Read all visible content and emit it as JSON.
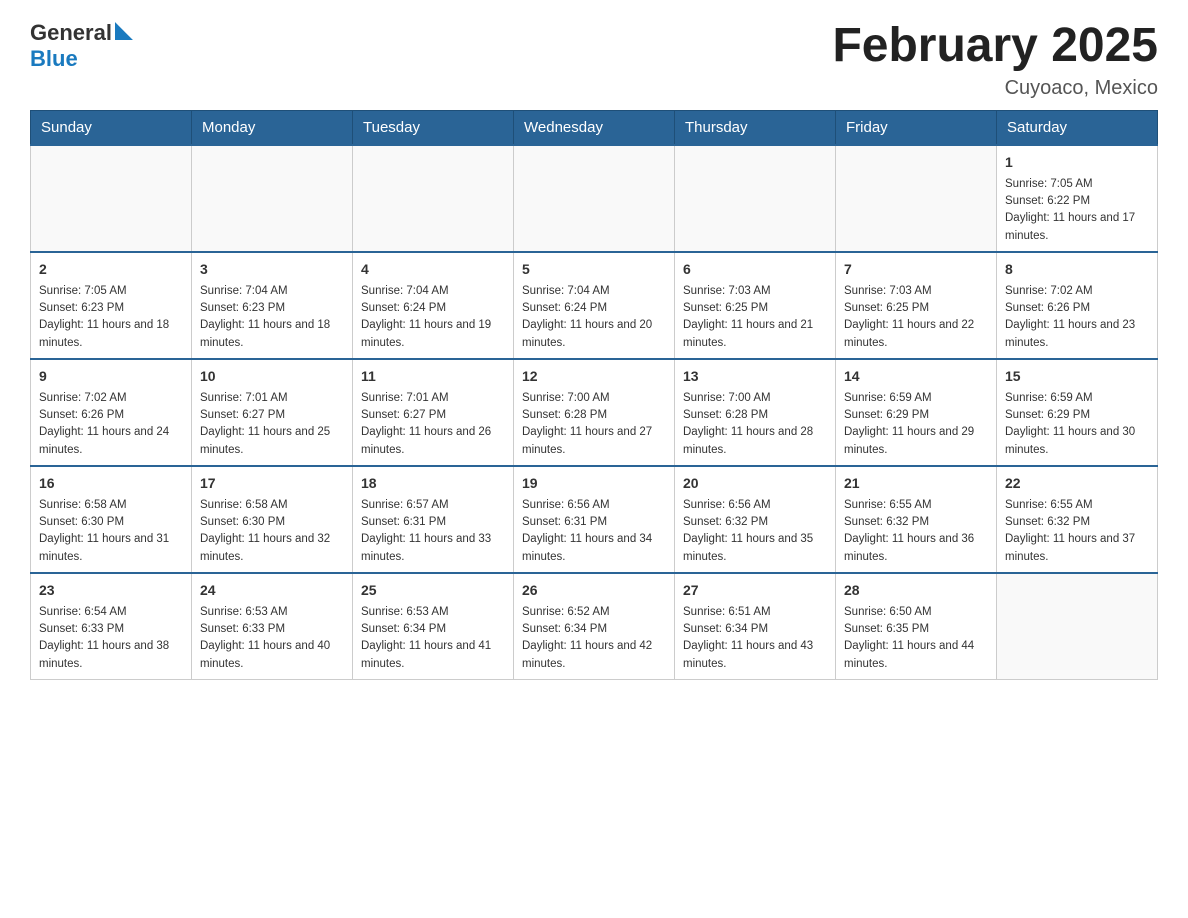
{
  "header": {
    "logo_general": "General",
    "logo_blue": "Blue",
    "title": "February 2025",
    "subtitle": "Cuyoaco, Mexico"
  },
  "weekdays": [
    "Sunday",
    "Monday",
    "Tuesday",
    "Wednesday",
    "Thursday",
    "Friday",
    "Saturday"
  ],
  "weeks": [
    [
      {
        "day": "",
        "sunrise": "",
        "sunset": "",
        "daylight": ""
      },
      {
        "day": "",
        "sunrise": "",
        "sunset": "",
        "daylight": ""
      },
      {
        "day": "",
        "sunrise": "",
        "sunset": "",
        "daylight": ""
      },
      {
        "day": "",
        "sunrise": "",
        "sunset": "",
        "daylight": ""
      },
      {
        "day": "",
        "sunrise": "",
        "sunset": "",
        "daylight": ""
      },
      {
        "day": "",
        "sunrise": "",
        "sunset": "",
        "daylight": ""
      },
      {
        "day": "1",
        "sunrise": "Sunrise: 7:05 AM",
        "sunset": "Sunset: 6:22 PM",
        "daylight": "Daylight: 11 hours and 17 minutes."
      }
    ],
    [
      {
        "day": "2",
        "sunrise": "Sunrise: 7:05 AM",
        "sunset": "Sunset: 6:23 PM",
        "daylight": "Daylight: 11 hours and 18 minutes."
      },
      {
        "day": "3",
        "sunrise": "Sunrise: 7:04 AM",
        "sunset": "Sunset: 6:23 PM",
        "daylight": "Daylight: 11 hours and 18 minutes."
      },
      {
        "day": "4",
        "sunrise": "Sunrise: 7:04 AM",
        "sunset": "Sunset: 6:24 PM",
        "daylight": "Daylight: 11 hours and 19 minutes."
      },
      {
        "day": "5",
        "sunrise": "Sunrise: 7:04 AM",
        "sunset": "Sunset: 6:24 PM",
        "daylight": "Daylight: 11 hours and 20 minutes."
      },
      {
        "day": "6",
        "sunrise": "Sunrise: 7:03 AM",
        "sunset": "Sunset: 6:25 PM",
        "daylight": "Daylight: 11 hours and 21 minutes."
      },
      {
        "day": "7",
        "sunrise": "Sunrise: 7:03 AM",
        "sunset": "Sunset: 6:25 PM",
        "daylight": "Daylight: 11 hours and 22 minutes."
      },
      {
        "day": "8",
        "sunrise": "Sunrise: 7:02 AM",
        "sunset": "Sunset: 6:26 PM",
        "daylight": "Daylight: 11 hours and 23 minutes."
      }
    ],
    [
      {
        "day": "9",
        "sunrise": "Sunrise: 7:02 AM",
        "sunset": "Sunset: 6:26 PM",
        "daylight": "Daylight: 11 hours and 24 minutes."
      },
      {
        "day": "10",
        "sunrise": "Sunrise: 7:01 AM",
        "sunset": "Sunset: 6:27 PM",
        "daylight": "Daylight: 11 hours and 25 minutes."
      },
      {
        "day": "11",
        "sunrise": "Sunrise: 7:01 AM",
        "sunset": "Sunset: 6:27 PM",
        "daylight": "Daylight: 11 hours and 26 minutes."
      },
      {
        "day": "12",
        "sunrise": "Sunrise: 7:00 AM",
        "sunset": "Sunset: 6:28 PM",
        "daylight": "Daylight: 11 hours and 27 minutes."
      },
      {
        "day": "13",
        "sunrise": "Sunrise: 7:00 AM",
        "sunset": "Sunset: 6:28 PM",
        "daylight": "Daylight: 11 hours and 28 minutes."
      },
      {
        "day": "14",
        "sunrise": "Sunrise: 6:59 AM",
        "sunset": "Sunset: 6:29 PM",
        "daylight": "Daylight: 11 hours and 29 minutes."
      },
      {
        "day": "15",
        "sunrise": "Sunrise: 6:59 AM",
        "sunset": "Sunset: 6:29 PM",
        "daylight": "Daylight: 11 hours and 30 minutes."
      }
    ],
    [
      {
        "day": "16",
        "sunrise": "Sunrise: 6:58 AM",
        "sunset": "Sunset: 6:30 PM",
        "daylight": "Daylight: 11 hours and 31 minutes."
      },
      {
        "day": "17",
        "sunrise": "Sunrise: 6:58 AM",
        "sunset": "Sunset: 6:30 PM",
        "daylight": "Daylight: 11 hours and 32 minutes."
      },
      {
        "day": "18",
        "sunrise": "Sunrise: 6:57 AM",
        "sunset": "Sunset: 6:31 PM",
        "daylight": "Daylight: 11 hours and 33 minutes."
      },
      {
        "day": "19",
        "sunrise": "Sunrise: 6:56 AM",
        "sunset": "Sunset: 6:31 PM",
        "daylight": "Daylight: 11 hours and 34 minutes."
      },
      {
        "day": "20",
        "sunrise": "Sunrise: 6:56 AM",
        "sunset": "Sunset: 6:32 PM",
        "daylight": "Daylight: 11 hours and 35 minutes."
      },
      {
        "day": "21",
        "sunrise": "Sunrise: 6:55 AM",
        "sunset": "Sunset: 6:32 PM",
        "daylight": "Daylight: 11 hours and 36 minutes."
      },
      {
        "day": "22",
        "sunrise": "Sunrise: 6:55 AM",
        "sunset": "Sunset: 6:32 PM",
        "daylight": "Daylight: 11 hours and 37 minutes."
      }
    ],
    [
      {
        "day": "23",
        "sunrise": "Sunrise: 6:54 AM",
        "sunset": "Sunset: 6:33 PM",
        "daylight": "Daylight: 11 hours and 38 minutes."
      },
      {
        "day": "24",
        "sunrise": "Sunrise: 6:53 AM",
        "sunset": "Sunset: 6:33 PM",
        "daylight": "Daylight: 11 hours and 40 minutes."
      },
      {
        "day": "25",
        "sunrise": "Sunrise: 6:53 AM",
        "sunset": "Sunset: 6:34 PM",
        "daylight": "Daylight: 11 hours and 41 minutes."
      },
      {
        "day": "26",
        "sunrise": "Sunrise: 6:52 AM",
        "sunset": "Sunset: 6:34 PM",
        "daylight": "Daylight: 11 hours and 42 minutes."
      },
      {
        "day": "27",
        "sunrise": "Sunrise: 6:51 AM",
        "sunset": "Sunset: 6:34 PM",
        "daylight": "Daylight: 11 hours and 43 minutes."
      },
      {
        "day": "28",
        "sunrise": "Sunrise: 6:50 AM",
        "sunset": "Sunset: 6:35 PM",
        "daylight": "Daylight: 11 hours and 44 minutes."
      },
      {
        "day": "",
        "sunrise": "",
        "sunset": "",
        "daylight": ""
      }
    ]
  ]
}
